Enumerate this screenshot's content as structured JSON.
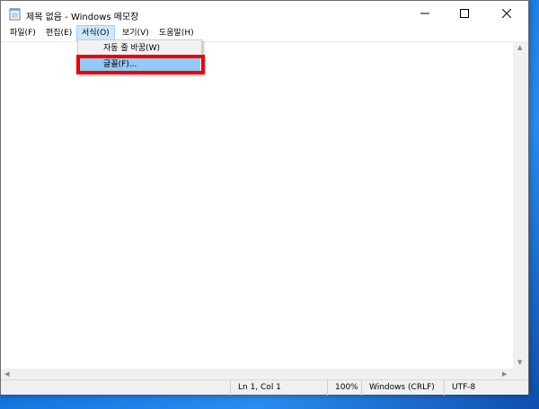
{
  "window": {
    "title": "제목 없음 - Windows 메모장",
    "app_icon": "notepad-icon",
    "controls": {
      "minimize_icon": "minimize-icon",
      "maximize_icon": "maximize-icon",
      "close_icon": "close-icon"
    }
  },
  "menubar": {
    "items": [
      {
        "label": "파일(F)"
      },
      {
        "label": "편집(E)"
      },
      {
        "label": "서식(O)"
      },
      {
        "label": "보기(V)"
      },
      {
        "label": "도움말(H)"
      }
    ],
    "open_menu": "서식(O)"
  },
  "format_menu": {
    "items": [
      {
        "label": "자동 줄 바꿈(W)"
      },
      {
        "label": "글꼴(F)..."
      }
    ],
    "highlighted": "글꼴(F)..."
  },
  "editor": {
    "content": ""
  },
  "statusbar": {
    "position": "Ln 1, Col 1",
    "zoom": "100%",
    "line_ending": "Windows (CRLF)",
    "encoding": "UTF-8"
  },
  "colors": {
    "menu_open_bg": "#cce8ff",
    "menu_hover_bg": "#91c9f7",
    "annotation_red": "#ee0000",
    "desktop_blue": "#1678e0"
  }
}
